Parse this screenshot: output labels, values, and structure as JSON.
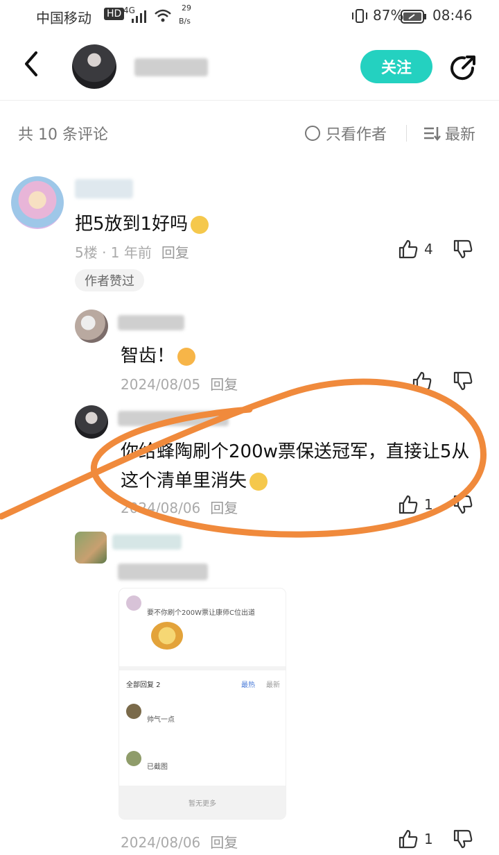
{
  "status_bar": {
    "carrier": "中国移动",
    "hd": "HD",
    "signal": "4G",
    "speed_top": "29",
    "speed_unit": "B/s",
    "battery": "87%",
    "time": "08:46"
  },
  "header": {
    "follow_label": "关注"
  },
  "toolbar": {
    "comment_count": "共 10 条评论",
    "author_only": "只看作者",
    "sort": "最新"
  },
  "comments": [
    {
      "text": "把5放到1好吗",
      "floor": "5楼 · 1 年前",
      "reply": "回复",
      "likes": "4",
      "badge": "作者赞过"
    }
  ],
  "replies": [
    {
      "text": "智齿！",
      "date": "2024/08/05",
      "reply": "回复"
    },
    {
      "text": "你给蜂陶刷个200w票保送冠军，直接让5从这个清单里消失",
      "date": "2024/08/06",
      "reply": "回复",
      "likes": "1"
    },
    {
      "date": "2024/08/06",
      "reply": "回复",
      "likes": "1"
    }
  ],
  "embedded_screenshot": {
    "post_text": "要不你刷个200W票让康师C位出道",
    "all_replies": "全部回复 2",
    "sort_hot": "最热",
    "sort_new": "最新",
    "reply1": "帅气一点",
    "reply2": "已截图",
    "footer": "暂无更多"
  },
  "colors": {
    "accent": "#24d1c0",
    "annotation_orange": "#f08a3c"
  }
}
